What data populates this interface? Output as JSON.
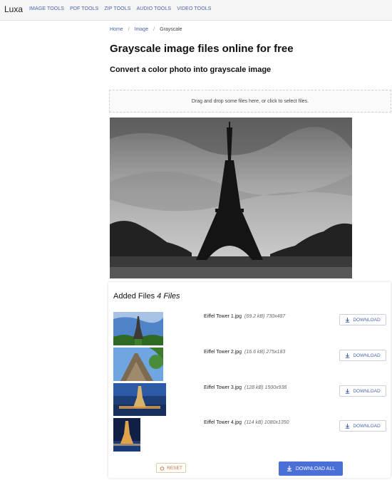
{
  "brand": "Luxa",
  "nav": [
    "IMAGE TOOLS",
    "PDF TOOLS",
    "ZIP TOOLS",
    "AUDIO TOOLS",
    "VIDEO TOOLS"
  ],
  "breadcrumb": {
    "home": "Home",
    "sep": "/",
    "image": "Image",
    "current": "Grayscale"
  },
  "title": "Grayscale image files online for free",
  "subtitle": "Convert a color photo into grayscale image",
  "dropzone": "Drag and drop some files here, or click to select files.",
  "files": {
    "heading": "Added Files",
    "count": "4 Files",
    "items": [
      {
        "name": "Eiffel Tower 1.jpg",
        "size": "(69.2 kB)",
        "dims": "730x487"
      },
      {
        "name": "Eiffel Tower 2.jpg",
        "size": "(16.6 kB)",
        "dims": "275x183"
      },
      {
        "name": "Eiffel Tower 3.jpg",
        "size": "(128 kB)",
        "dims": "1500x938"
      },
      {
        "name": "Eiffel Tower 4.jpg",
        "size": "(114 kB)",
        "dims": "1080x1350"
      }
    ],
    "download_label": "DOWNLOAD",
    "reset_label": "RESET",
    "download_all_label": "DOWNLOAD ALL"
  },
  "colors": {
    "accent": "#4a6fd6",
    "link": "#4a63a8",
    "reset": "#c0713a"
  },
  "icons": {
    "download": "download-icon",
    "reset": "power-icon"
  }
}
